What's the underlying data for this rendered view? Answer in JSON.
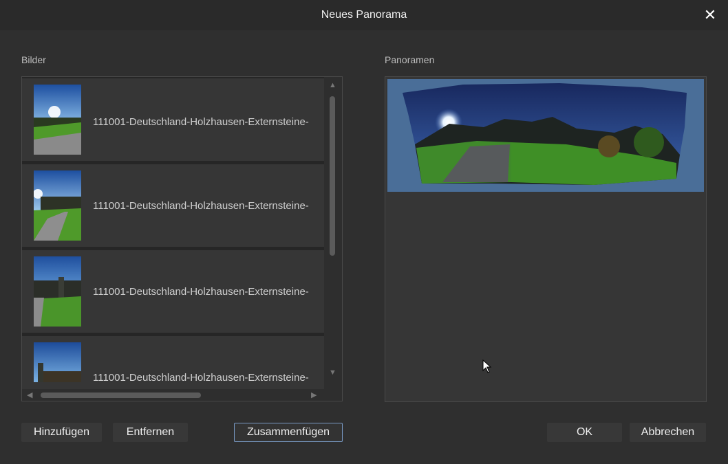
{
  "window": {
    "title": "Neues Panorama"
  },
  "images_section": {
    "label": "Bilder",
    "items": [
      {
        "label": "111001-Deutschland-Holzhausen-Externsteine-"
      },
      {
        "label": "111001-Deutschland-Holzhausen-Externsteine-"
      },
      {
        "label": "111001-Deutschland-Holzhausen-Externsteine-"
      },
      {
        "label": "111001-Deutschland-Holzhausen-Externsteine-"
      }
    ]
  },
  "panoramas_section": {
    "label": "Panoramen"
  },
  "buttons": {
    "add": "Hinzufügen",
    "remove": "Entfernen",
    "stitch": "Zusammenfügen",
    "ok": "OK",
    "cancel": "Abbrechen"
  },
  "colors": {
    "background": "#2f2f2f",
    "accent_border": "#7a9cc8",
    "selection": "#4a6e98"
  },
  "icons": {
    "close": "close-icon"
  }
}
